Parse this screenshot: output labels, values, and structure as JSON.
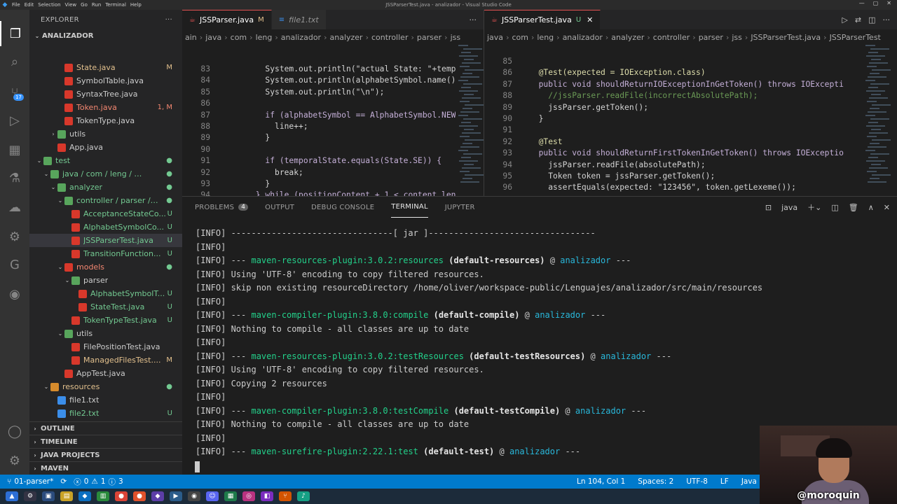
{
  "window": {
    "title": "JSSParserTest.java - analizador - Visual Studio Code",
    "menu": [
      "File",
      "Edit",
      "Selection",
      "View",
      "Go",
      "Run",
      "Terminal",
      "Help"
    ]
  },
  "activity": {
    "scm_badge": "17"
  },
  "sidebar": {
    "header": "EXPLORER",
    "root": "ANALIZADOR",
    "tree": [
      {
        "name": "State.java",
        "status": "M",
        "indent": 3,
        "icon": "java",
        "chev": ""
      },
      {
        "name": "SymbolTable.java",
        "status": "",
        "indent": 3,
        "icon": "java",
        "chev": ""
      },
      {
        "name": "SyntaxTree.java",
        "status": "",
        "indent": 3,
        "icon": "java",
        "chev": ""
      },
      {
        "name": "Token.java",
        "status": "1, M",
        "indent": 3,
        "icon": "java",
        "chev": ""
      },
      {
        "name": "TokenType.java",
        "status": "",
        "indent": 3,
        "icon": "java",
        "chev": ""
      },
      {
        "name": "utils",
        "status": "",
        "indent": 2,
        "icon": "folder",
        "chev": "›"
      },
      {
        "name": "App.java",
        "status": "",
        "indent": 2,
        "icon": "java",
        "chev": ""
      },
      {
        "name": "test",
        "status": "dot",
        "indent": 0,
        "icon": "folder",
        "chev": "⌄"
      },
      {
        "name": "java / com / leng / anali...",
        "status": "dot",
        "indent": 1,
        "icon": "folder",
        "chev": "⌄"
      },
      {
        "name": "analyzer",
        "status": "dot",
        "indent": 2,
        "icon": "folder",
        "chev": "⌄"
      },
      {
        "name": "controller / parser / j...",
        "status": "dot",
        "indent": 3,
        "icon": "folder",
        "chev": "⌄"
      },
      {
        "name": "AcceptanceStateCo...",
        "status": "U",
        "indent": 4,
        "icon": "java",
        "chev": ""
      },
      {
        "name": "AlphabetSymbolCo...",
        "status": "U",
        "indent": 4,
        "icon": "java",
        "chev": ""
      },
      {
        "name": "JSSParserTest.java",
        "status": "U",
        "indent": 4,
        "icon": "java",
        "chev": "",
        "selected": true
      },
      {
        "name": "TransitionFunction...",
        "status": "U",
        "indent": 4,
        "icon": "java",
        "chev": ""
      },
      {
        "name": "models",
        "status": "dot",
        "indent": 3,
        "icon": "folder-red",
        "chev": "⌄"
      },
      {
        "name": "parser",
        "status": "",
        "indent": 4,
        "icon": "folder",
        "chev": "⌄"
      },
      {
        "name": "AlphabetSymbolT...",
        "status": "U",
        "indent": 5,
        "icon": "java",
        "chev": ""
      },
      {
        "name": "StateTest.java",
        "status": "U",
        "indent": 5,
        "icon": "java",
        "chev": ""
      },
      {
        "name": "TokenTypeTest.java",
        "status": "U",
        "indent": 4,
        "icon": "java",
        "chev": ""
      },
      {
        "name": "utils",
        "status": "",
        "indent": 3,
        "icon": "folder",
        "chev": "⌄"
      },
      {
        "name": "FilePositionTest.java",
        "status": "",
        "indent": 4,
        "icon": "java",
        "chev": ""
      },
      {
        "name": "ManagedFilesTest....",
        "status": "M",
        "indent": 4,
        "icon": "java",
        "chev": ""
      },
      {
        "name": "AppTest.java",
        "status": "",
        "indent": 3,
        "icon": "java",
        "chev": ""
      },
      {
        "name": "resources",
        "status": "dot",
        "indent": 1,
        "icon": "folder-orange",
        "chev": "⌄"
      },
      {
        "name": "file1.txt",
        "status": "",
        "indent": 2,
        "icon": "txt",
        "chev": ""
      },
      {
        "name": "file2.txt",
        "status": "U",
        "indent": 2,
        "icon": "txt",
        "chev": ""
      }
    ],
    "sections": [
      "OUTLINE",
      "TIMELINE",
      "JAVA PROJECTS",
      "MAVEN"
    ]
  },
  "editor_left": {
    "tabs": [
      {
        "label": "JSSParser.java",
        "mark": "M",
        "active": true
      },
      {
        "label": "file1.txt",
        "mark": "",
        "active": false
      }
    ],
    "breadcrumb": [
      "ain",
      "java",
      "com",
      "leng",
      "analizador",
      "analyzer",
      "controller",
      "parser",
      "jss"
    ],
    "lines": [
      {
        "n": "83",
        "code": "        System.out.println(\"actual State: \"+temp"
      },
      {
        "n": "84",
        "code": "        System.out.println(alphabetSymbol.name()"
      },
      {
        "n": "85",
        "code": "        System.out.println(\"\\n\");"
      },
      {
        "n": "86",
        "code": ""
      },
      {
        "n": "87",
        "code": "        if (alphabetSymbol == AlphabetSymbol.NEW"
      },
      {
        "n": "88",
        "code": "          line++;"
      },
      {
        "n": "89",
        "code": "        }"
      },
      {
        "n": "90",
        "code": ""
      },
      {
        "n": "91",
        "code": "        if (temporalState.equals(State.SE)) {"
      },
      {
        "n": "92",
        "code": "          break;"
      },
      {
        "n": "93",
        "code": "        }"
      },
      {
        "n": "94",
        "code": "      } while (positionContent + 1 < content.len"
      }
    ]
  },
  "editor_right": {
    "tabs": [
      {
        "label": "JSSParserTest.java",
        "mark": "U",
        "active": true
      }
    ],
    "breadcrumb": [
      "java",
      "com",
      "leng",
      "analizador",
      "analyzer",
      "controller",
      "parser",
      "jss",
      "JSSParserTest.java",
      "JSSParserTest"
    ],
    "lines": [
      {
        "n": "85",
        "code": ""
      },
      {
        "n": "86",
        "code": "  @Test(expected = IOException.class)"
      },
      {
        "n": "87",
        "code": "  public void shouldReturnIOExceptionInGetToken() throws IOExcepti"
      },
      {
        "n": "88",
        "code": "    //jssParser.readFile(incorrectAbsolutePath);"
      },
      {
        "n": "89",
        "code": "    jssParser.getToken();"
      },
      {
        "n": "90",
        "code": "  }"
      },
      {
        "n": "91",
        "code": ""
      },
      {
        "n": "92",
        "code": "  @Test"
      },
      {
        "n": "93",
        "code": "  public void shouldReturnFirstTokenInGetToken() throws IOExceptio"
      },
      {
        "n": "94",
        "code": "    jssParser.readFile(absolutePath);"
      },
      {
        "n": "95",
        "code": "    Token token = jssParser.getToken();"
      },
      {
        "n": "96",
        "code": "    assertEquals(expected: \"123456\", token.getLexeme());"
      }
    ]
  },
  "panel": {
    "tabs": [
      "PROBLEMS",
      "OUTPUT",
      "DEBUG CONSOLE",
      "TERMINAL",
      "JUPYTER"
    ],
    "problems_count": "4",
    "active_tab": "TERMINAL",
    "terminal_name": "java",
    "terminal": [
      {
        "pre": "[INFO] --------------------------------[ jar ]---------------------------------",
        "plugin": "",
        "mid": "",
        "bold": "",
        "at": "",
        "proj": "",
        "post": ""
      },
      {
        "pre": "[INFO] ",
        "plugin": "",
        "mid": "",
        "bold": "",
        "at": "",
        "proj": "",
        "post": ""
      },
      {
        "pre": "[INFO] --- ",
        "plugin": "maven-resources-plugin:3.0.2:resources",
        "mid": " ",
        "bold": "(default-resources)",
        "at": " @ ",
        "proj": "analizador",
        "post": " ---"
      },
      {
        "pre": "[INFO] Using 'UTF-8' encoding to copy filtered resources.",
        "plugin": "",
        "mid": "",
        "bold": "",
        "at": "",
        "proj": "",
        "post": ""
      },
      {
        "pre": "[INFO] skip non existing resourceDirectory /home/oliver/workspace-public/Lenguajes/analizador/src/main/resources",
        "plugin": "",
        "mid": "",
        "bold": "",
        "at": "",
        "proj": "",
        "post": ""
      },
      {
        "pre": "[INFO] ",
        "plugin": "",
        "mid": "",
        "bold": "",
        "at": "",
        "proj": "",
        "post": ""
      },
      {
        "pre": "[INFO] --- ",
        "plugin": "maven-compiler-plugin:3.8.0:compile",
        "mid": " ",
        "bold": "(default-compile)",
        "at": " @ ",
        "proj": "analizador",
        "post": " ---"
      },
      {
        "pre": "[INFO] Nothing to compile - all classes are up to date",
        "plugin": "",
        "mid": "",
        "bold": "",
        "at": "",
        "proj": "",
        "post": ""
      },
      {
        "pre": "[INFO] ",
        "plugin": "",
        "mid": "",
        "bold": "",
        "at": "",
        "proj": "",
        "post": ""
      },
      {
        "pre": "[INFO] --- ",
        "plugin": "maven-resources-plugin:3.0.2:testResources",
        "mid": " ",
        "bold": "(default-testResources)",
        "at": " @ ",
        "proj": "analizador",
        "post": " ---"
      },
      {
        "pre": "[INFO] Using 'UTF-8' encoding to copy filtered resources.",
        "plugin": "",
        "mid": "",
        "bold": "",
        "at": "",
        "proj": "",
        "post": ""
      },
      {
        "pre": "[INFO] Copying 2 resources",
        "plugin": "",
        "mid": "",
        "bold": "",
        "at": "",
        "proj": "",
        "post": ""
      },
      {
        "pre": "[INFO] ",
        "plugin": "",
        "mid": "",
        "bold": "",
        "at": "",
        "proj": "",
        "post": ""
      },
      {
        "pre": "[INFO] --- ",
        "plugin": "maven-compiler-plugin:3.8.0:testCompile",
        "mid": " ",
        "bold": "(default-testCompile)",
        "at": " @ ",
        "proj": "analizador",
        "post": " ---"
      },
      {
        "pre": "[INFO] Nothing to compile - all classes are up to date",
        "plugin": "",
        "mid": "",
        "bold": "",
        "at": "",
        "proj": "",
        "post": ""
      },
      {
        "pre": "[INFO] ",
        "plugin": "",
        "mid": "",
        "bold": "",
        "at": "",
        "proj": "",
        "post": ""
      },
      {
        "pre": "[INFO] --- ",
        "plugin": "maven-surefire-plugin:2.22.1:test",
        "mid": " ",
        "bold": "(default-test)",
        "at": " @ ",
        "proj": "analizador",
        "post": " ---"
      }
    ]
  },
  "status": {
    "branch": "01-parser*",
    "errors": "0",
    "warnings": "1",
    "info": "3",
    "position": "Ln 104, Col 1",
    "spaces": "Spaces: 2",
    "encoding": "UTF-8",
    "eol": "LF",
    "language": "Java"
  },
  "webcam": {
    "handle": "@moroquin"
  },
  "colors": {
    "accent": "#007acc",
    "activity_bg": "#333333",
    "sidebar_bg": "#252526",
    "editor_bg": "#1e1e1e"
  }
}
